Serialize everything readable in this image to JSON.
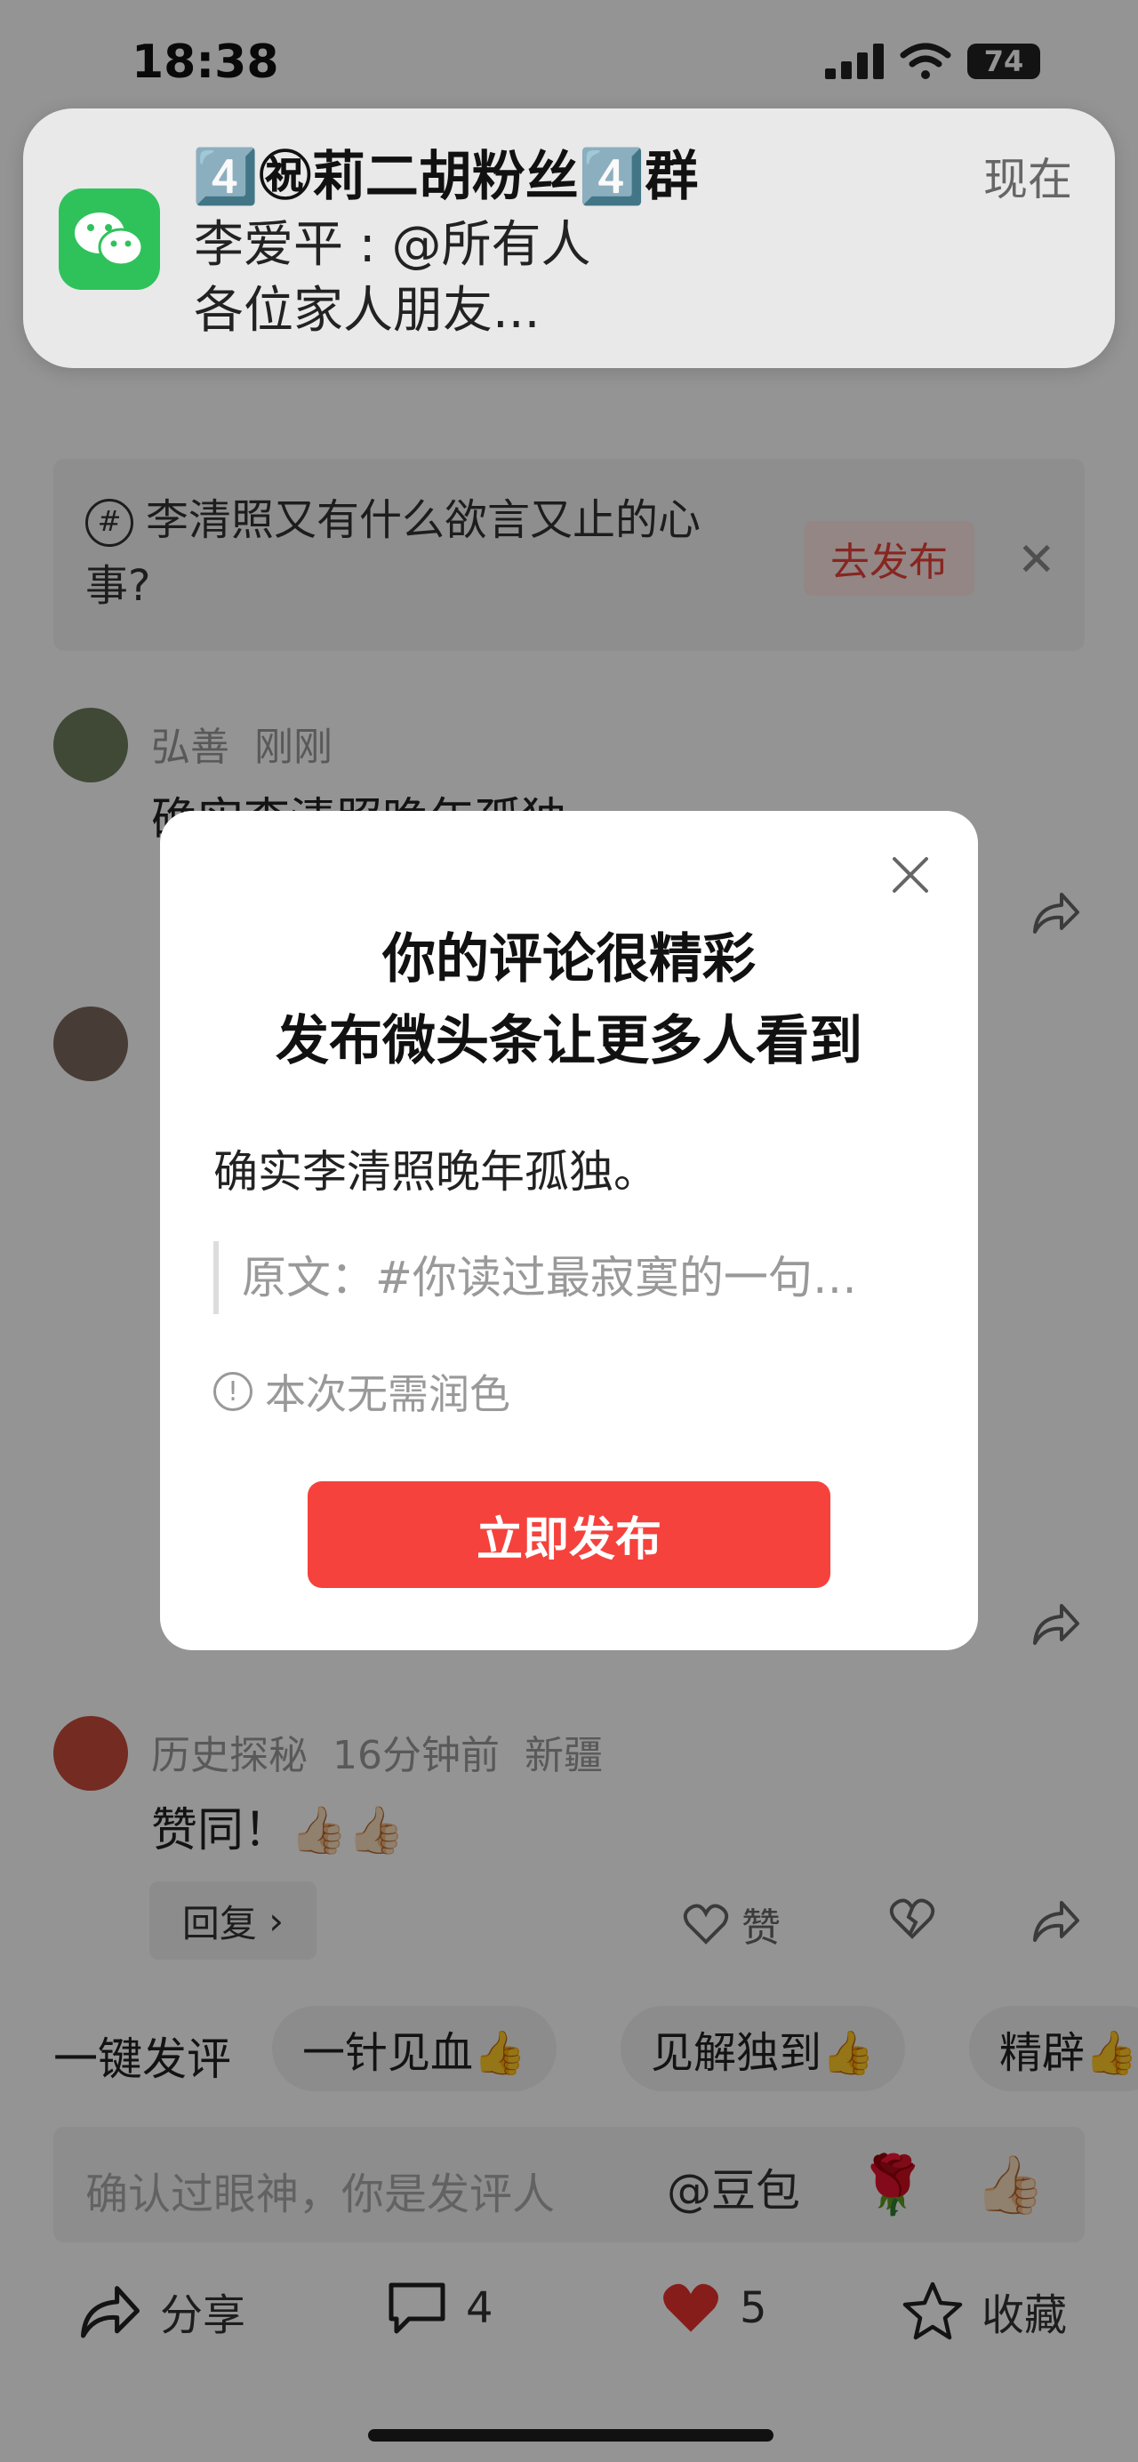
{
  "status_bar": {
    "time": "18:38",
    "battery": "74"
  },
  "notification": {
    "app_icon": "wechat-icon",
    "title": "4️⃣㊗莉二胡粉丝4️⃣群",
    "sender_line": "李爱平 : @所有人",
    "preview": "各位家人朋友...",
    "time": "现在"
  },
  "hint": {
    "text": "李清照又有什么欲言又止的心事?",
    "publish": "去发布"
  },
  "comments": [
    {
      "name": "弘善",
      "time": "刚刚",
      "text": "确实李清照晚年孤独。"
    },
    {
      "name": "历史探秘",
      "time": "16分钟前",
      "location": "新疆",
      "text": "赞同！👍🏻👍🏻",
      "reply": "回复",
      "like": "赞"
    }
  ],
  "quick_replies": {
    "lead": "一键发评",
    "chips": [
      "一针见血👍",
      "见解独到👍",
      "精辟👍"
    ]
  },
  "input": {
    "placeholder": "确认过眼神，你是发评人",
    "mention": "@豆包"
  },
  "bottom_bar": {
    "share": "分享",
    "comments": "4",
    "likes": "5",
    "favorite": "收藏"
  },
  "modal": {
    "title_line1": "你的评论很精彩",
    "title_line2": "发布微头条让更多人看到",
    "comment": "确实李清照晚年孤独。",
    "original": "原文：#你读过最寂寞的一句…",
    "note": "本次无需润色",
    "publish_button": "立即发布"
  },
  "colors": {
    "accent": "#f5423c",
    "wechat": "#2fc25b",
    "like_red": "#e8332e"
  }
}
